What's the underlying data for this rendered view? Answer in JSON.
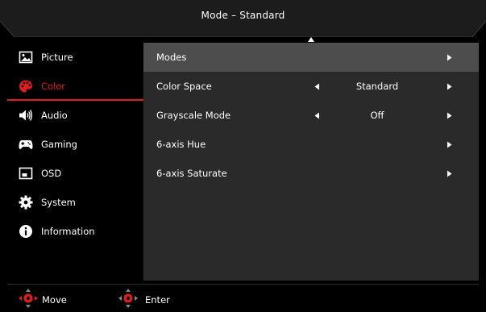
{
  "header": {
    "title": "Mode – Standard"
  },
  "sidebar": {
    "items": [
      {
        "label": "Picture",
        "icon": "picture-icon",
        "active": false
      },
      {
        "label": "Color",
        "icon": "palette-icon",
        "active": true
      },
      {
        "label": "Audio",
        "icon": "speaker-icon",
        "active": false
      },
      {
        "label": "Gaming",
        "icon": "gamepad-icon",
        "active": false
      },
      {
        "label": "OSD",
        "icon": "osd-icon",
        "active": false
      },
      {
        "label": "System",
        "icon": "gear-icon",
        "active": false
      },
      {
        "label": "Information",
        "icon": "info-icon",
        "active": false
      }
    ]
  },
  "main": {
    "rows": [
      {
        "label": "Modes",
        "value": "",
        "selected": true
      },
      {
        "label": "Color Space",
        "value": "Standard",
        "selected": false
      },
      {
        "label": "Grayscale Mode",
        "value": "Off",
        "selected": false
      },
      {
        "label": "6-axis Hue",
        "value": "",
        "selected": false
      },
      {
        "label": "6-axis Saturate",
        "value": "",
        "selected": false
      }
    ]
  },
  "footer": {
    "move_label": "Move",
    "enter_label": "Enter"
  },
  "colors": {
    "accent": "#e21c1c",
    "panel": "#2a2a2a",
    "selected_row": "#4d4d4d",
    "background": "#000000"
  }
}
